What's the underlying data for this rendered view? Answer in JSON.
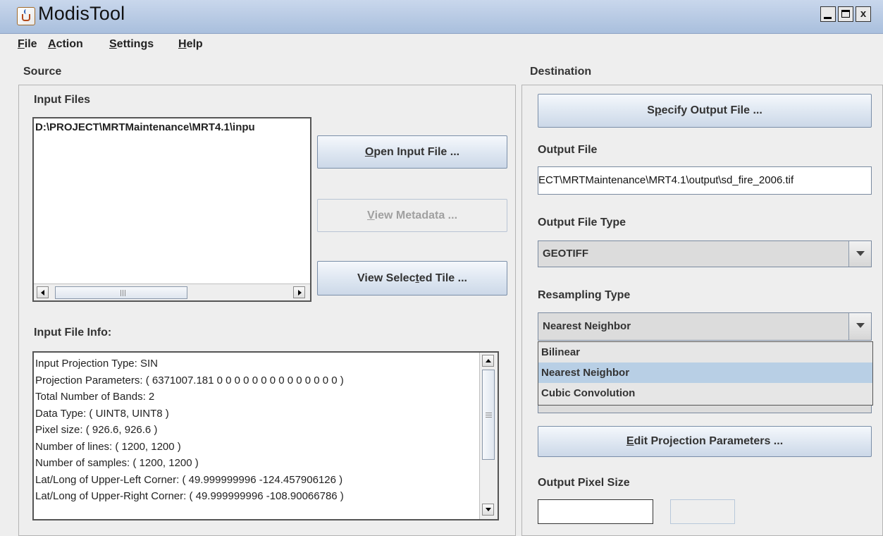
{
  "window": {
    "title": "ModisTool",
    "minimize_label": "_",
    "maximize_label": "□",
    "close_label": "x"
  },
  "menu": [
    {
      "key": "F",
      "rest": "ile"
    },
    {
      "key": "A",
      "rest": "ction"
    },
    {
      "key": "S",
      "rest": "ettings"
    },
    {
      "key": "H",
      "rest": "elp"
    }
  ],
  "source": {
    "label": "Source",
    "input_files_label": "Input Files",
    "input_files": [
      "D:\\PROJECT\\MRTMaintenance\\MRT4.1\\inpu"
    ],
    "open_input_button": {
      "pre": "",
      "key": "O",
      "post": "pen Input File ..."
    },
    "view_metadata_button": {
      "pre": "",
      "key": "V",
      "post": "iew Metadata ..."
    },
    "view_tile_button": {
      "pre": "View Selec",
      "key": "t",
      "post": "ed Tile  ..."
    },
    "input_file_info_label": "Input File Info:",
    "input_file_info": [
      "Input Projection Type: SIN",
      "Projection Parameters: ( 6371007.181 0 0 0 0 0 0 0 0 0 0 0 0 0 0 )",
      "Total Number of Bands: 2",
      "Data Type: ( UINT8, UINT8 )",
      "Pixel size: ( 926.6, 926.6 )",
      "Number of lines: ( 1200, 1200 )",
      "Number of samples: ( 1200, 1200 )",
      "Lat/Long of Upper-Left Corner: ( 49.999999996 -124.457906126 )",
      "Lat/Long of Upper-Right Corner: ( 49.999999996 -108.90066786 )"
    ]
  },
  "destination": {
    "label": "Destination",
    "specify_output_button": {
      "pre": "S",
      "key": "p",
      "post": "ecify Output File ..."
    },
    "output_file_label": "Output File",
    "output_file_value": "ECT\\MRTMaintenance\\MRT4.1\\output\\sd_fire_2006.tif",
    "output_file_type_label": "Output File Type",
    "output_file_type_value": "GEOTIFF",
    "resampling_type_label": "Resampling Type",
    "resampling_type_value": "Nearest Neighbor",
    "resampling_options": [
      "Bilinear",
      "Nearest Neighbor",
      "Cubic Convolution"
    ],
    "resampling_selected_index": 1,
    "edit_projection_button": {
      "pre": "",
      "key": "E",
      "post": "dit Projection Parameters ..."
    },
    "output_pixel_size_label": "Output Pixel Size",
    "output_pixel_size_value": ""
  }
}
